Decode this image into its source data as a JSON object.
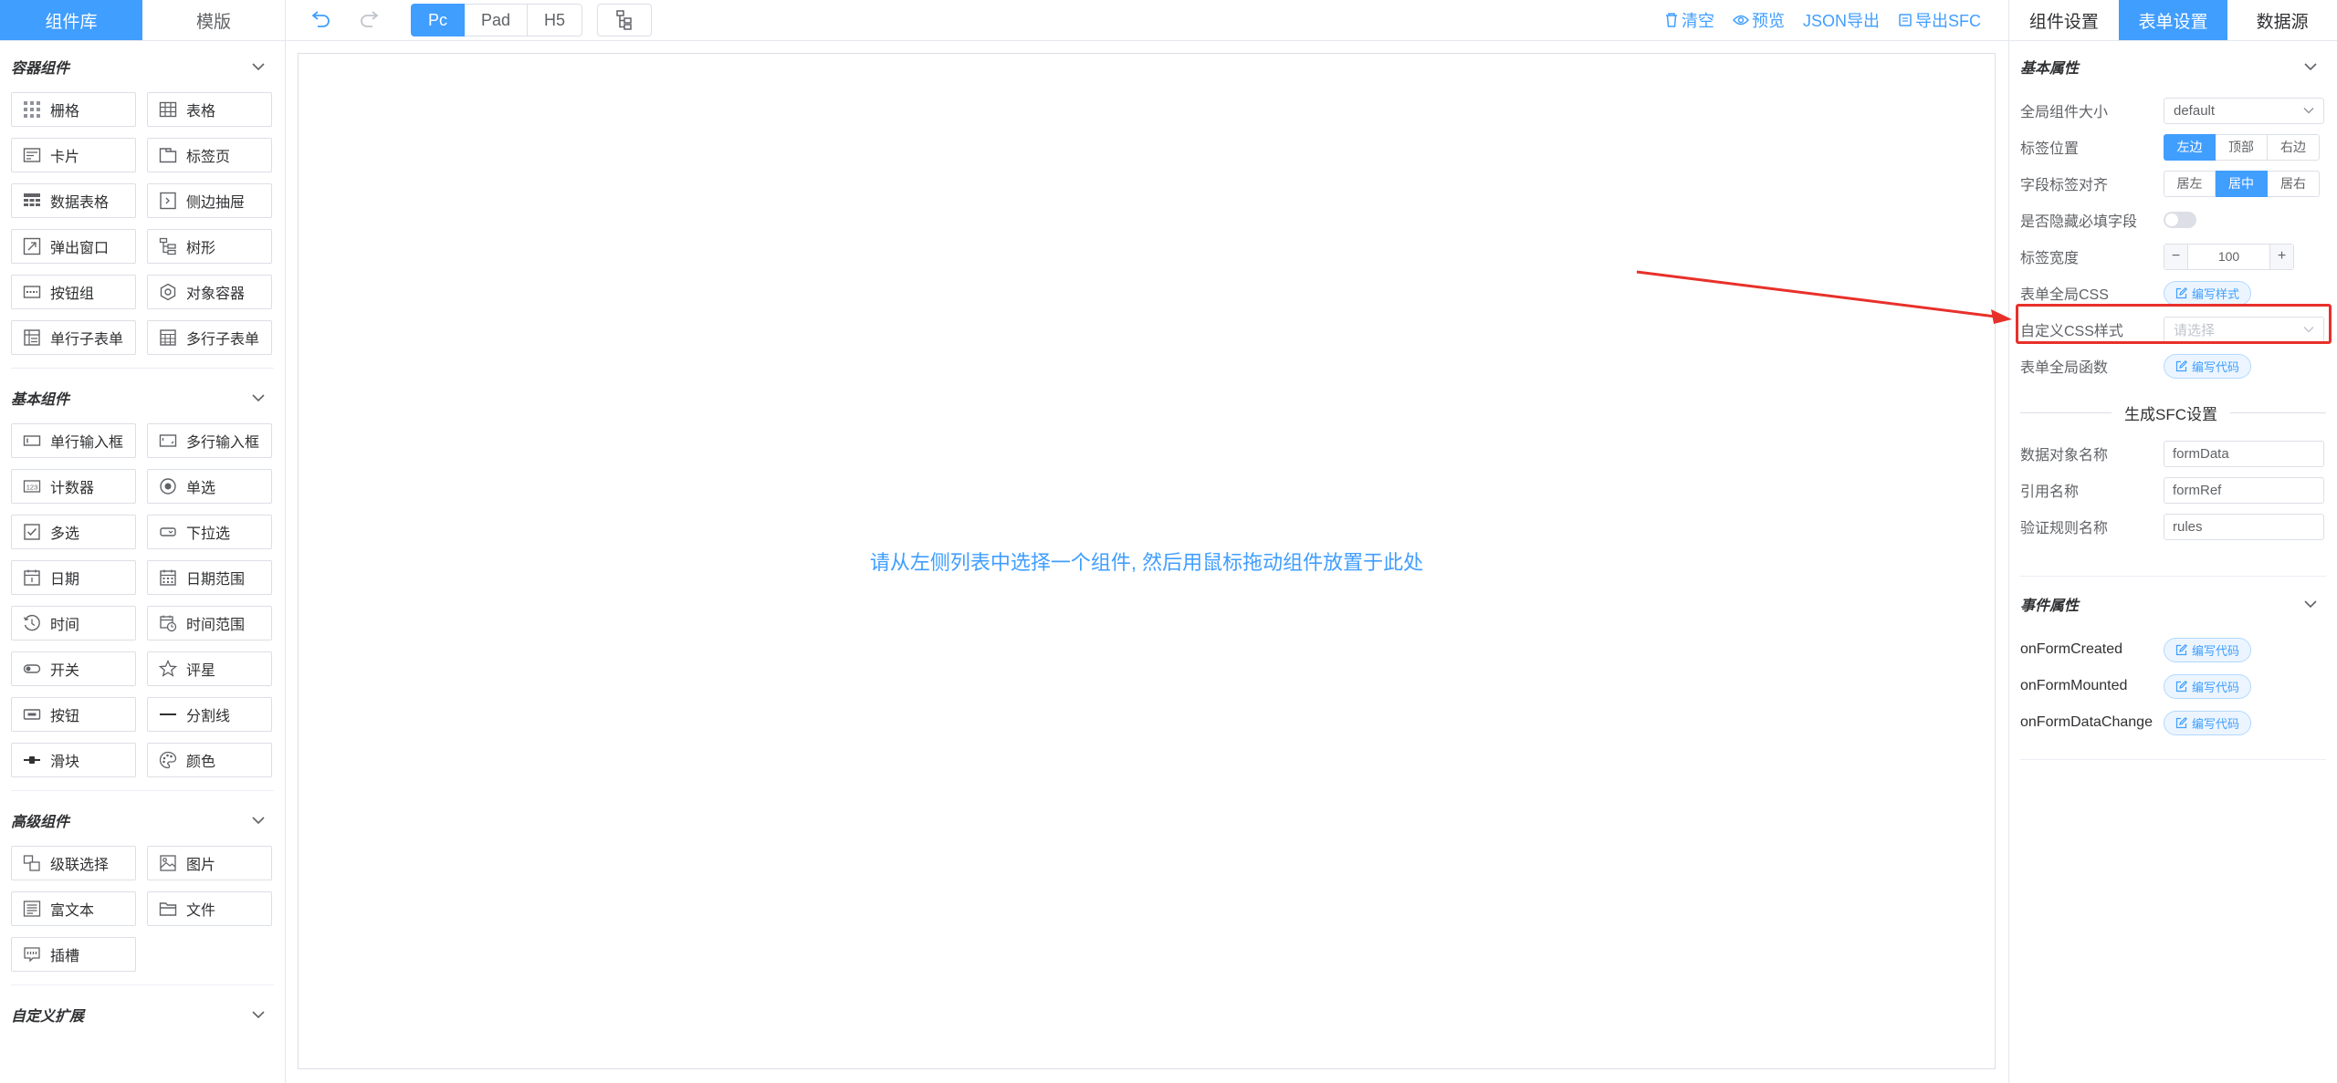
{
  "left_tabs": [
    "组件库",
    "模版"
  ],
  "toolbar": {
    "devices": [
      "Pc",
      "Pad",
      "H5"
    ],
    "actions": [
      "清空",
      "预览",
      "JSON导出",
      "导出SFC"
    ]
  },
  "right_tabs": [
    "组件设置",
    "表单设置",
    "数据源"
  ],
  "categories": {
    "container": {
      "title": "容器组件",
      "items": [
        "栅格",
        "表格",
        "卡片",
        "标签页",
        "数据表格",
        "侧边抽屉",
        "弹出窗口",
        "树形",
        "按钮组",
        "对象容器",
        "单行子表单",
        "多行子表单"
      ]
    },
    "basic": {
      "title": "基本组件",
      "items": [
        "单行输入框",
        "多行输入框",
        "计数器",
        "单选",
        "多选",
        "下拉选",
        "日期",
        "日期范围",
        "时间",
        "时间范围",
        "开关",
        "评星",
        "按钮",
        "分割线",
        "滑块",
        "颜色"
      ]
    },
    "advanced": {
      "title": "高级组件",
      "items": [
        "级联选择",
        "图片",
        "富文本",
        "文件",
        "插槽"
      ]
    },
    "custom": {
      "title": "自定义扩展"
    }
  },
  "canvas": {
    "hint": "请从左侧列表中选择一个组件, 然后用鼠标拖动组件放置于此处"
  },
  "form_settings": {
    "basic_title": "基本属性",
    "size_label": "全局组件大小",
    "size_value": "default",
    "label_position_label": "标签位置",
    "label_position_options": [
      "左边",
      "顶部",
      "右边"
    ],
    "label_position_selected": "左边",
    "label_align_label": "字段标签对齐",
    "label_align_options": [
      "居左",
      "居中",
      "居右"
    ],
    "label_align_selected": "居中",
    "hide_required_label": "是否隐藏必填字段",
    "hide_required_value": false,
    "label_width_label": "标签宽度",
    "label_width_value": "100",
    "global_css_label": "表单全局CSS",
    "global_css_button": "编写样式",
    "custom_css_label": "自定义CSS样式",
    "custom_css_placeholder": "请选择",
    "global_func_label": "表单全局函数",
    "global_func_button": "编写代码",
    "sfc_title": "生成SFC设置",
    "data_name_label": "数据对象名称",
    "data_name_value": "formData",
    "ref_name_label": "引用名称",
    "ref_name_value": "formRef",
    "rules_name_label": "验证规则名称",
    "rules_name_value": "rules",
    "event_title": "事件属性",
    "events": [
      "onFormCreated",
      "onFormMounted",
      "onFormDataChange"
    ],
    "event_button": "编写代码"
  },
  "colors": {
    "primary": "#409eff",
    "annotation": "#e8302a",
    "border": "#dcdfe6"
  }
}
